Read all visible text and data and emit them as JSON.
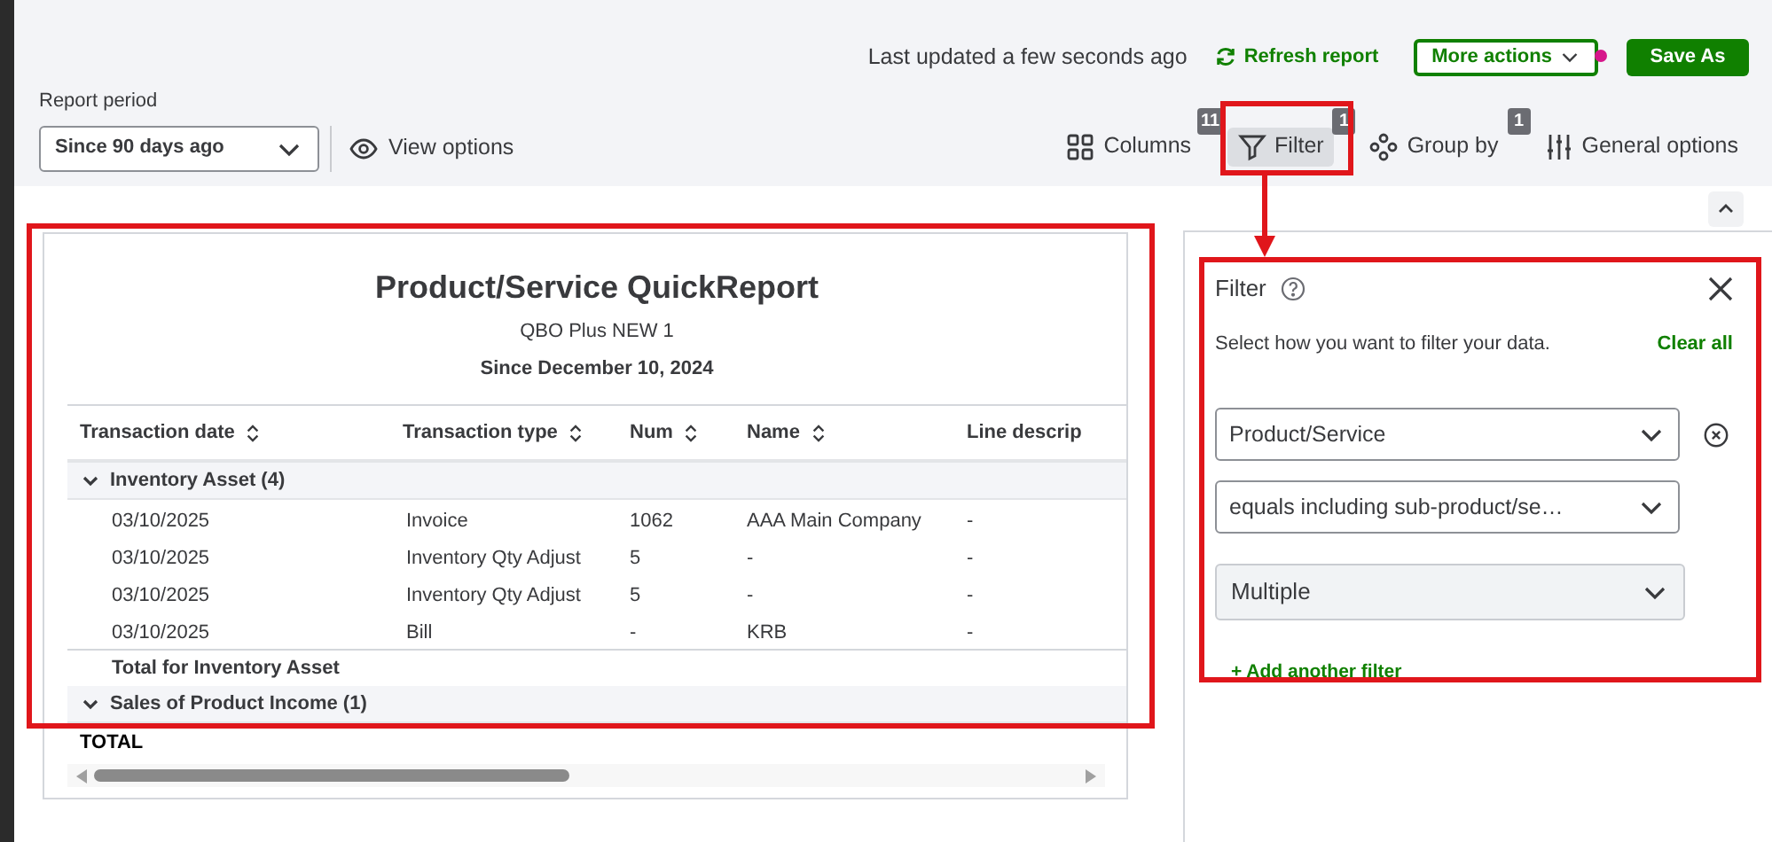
{
  "header": {
    "last_updated": "Last updated a few seconds ago",
    "refresh": "Refresh report",
    "more_actions": "More actions",
    "more_actions_dot": true,
    "save_as": "Save As"
  },
  "report_period": {
    "label": "Report period",
    "value": "Since 90 days ago"
  },
  "view_options": "View options",
  "toolbar": [
    {
      "kind": "columns",
      "label": "Columns",
      "badge": "11",
      "selected": false
    },
    {
      "kind": "filter",
      "label": "Filter",
      "badge": "1",
      "selected": true
    },
    {
      "kind": "group",
      "label": "Group by",
      "badge": "1",
      "selected": false
    },
    {
      "kind": "options",
      "label": "General options",
      "selected": false
    }
  ],
  "report": {
    "title": "Product/Service QuickReport",
    "company": "QBO Plus NEW 1",
    "period": "Since December 10, 2024",
    "columns": [
      "Transaction date",
      "Transaction type",
      "Num",
      "Name",
      "Line descrip"
    ],
    "groups": [
      {
        "name": "Inventory Asset (4)",
        "expanded": true,
        "rows": [
          [
            "03/10/2025",
            "Invoice",
            "1062",
            "AAA Main Company",
            "-"
          ],
          [
            "03/10/2025",
            "Inventory Qty Adjust",
            "5",
            "-",
            "-"
          ],
          [
            "03/10/2025",
            "Inventory Qty Adjust",
            "5",
            "-",
            "-"
          ],
          [
            "03/10/2025",
            "Bill",
            "-",
            "KRB",
            "-"
          ]
        ],
        "total": "Total for Inventory Asset"
      },
      {
        "name": "Sales of Product Income (1)",
        "expanded": true
      }
    ],
    "grand_total": "TOTAL"
  },
  "filter_panel": {
    "title": "Filter",
    "description": "Select how you want to filter your data.",
    "clear_all": "Clear all",
    "filters": [
      {
        "kind": "field",
        "value": "Product/Service",
        "removable": true
      },
      {
        "kind": "operator",
        "value": "equals including sub-product/se…",
        "removable": false
      },
      {
        "kind": "value",
        "value": "Multiple",
        "removable": false
      }
    ],
    "add_filter": "+ Add another filter"
  }
}
